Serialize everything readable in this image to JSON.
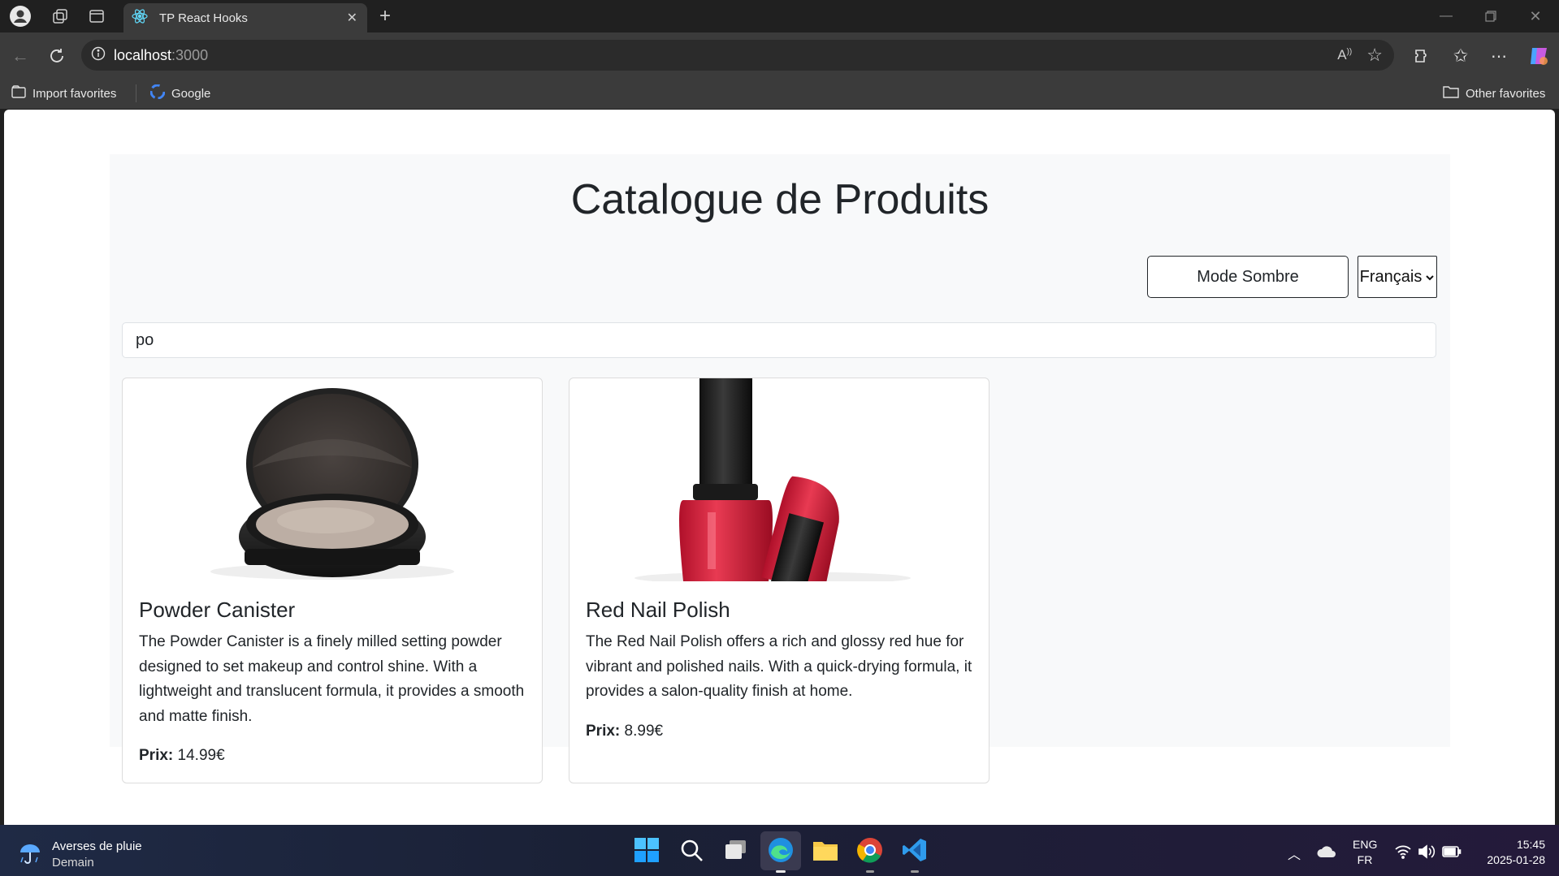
{
  "browser": {
    "tab_title": "TP React Hooks",
    "url_host": "localhost",
    "url_port": ":3000",
    "bookmarks": [
      "Import favorites",
      "Google"
    ],
    "other_favorites": "Other favorites"
  },
  "page": {
    "title": "Catalogue de Produits",
    "mode_button": "Mode Sombre",
    "language_select": "Français",
    "search_value": "po",
    "price_label": "Prix:",
    "products": [
      {
        "name": "Powder Canister",
        "description": "The Powder Canister is a finely milled setting powder designed to set makeup and control shine. With a lightweight and translucent formula, it provides a smooth and matte finish.",
        "price": "14.99€"
      },
      {
        "name": "Red Nail Polish",
        "description": "The Red Nail Polish offers a rich and glossy red hue for vibrant and polished nails. With a quick-drying formula, it provides a salon-quality finish at home.",
        "price": "8.99€"
      }
    ]
  },
  "taskbar": {
    "weather_title": "Averses de pluie",
    "weather_sub": "Demain",
    "lang_top": "ENG",
    "lang_bottom": "FR",
    "time": "15:45",
    "date": "2025-01-28"
  }
}
